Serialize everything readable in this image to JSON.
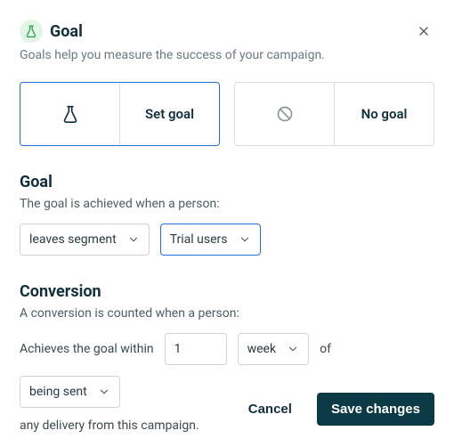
{
  "header": {
    "title": "Goal",
    "subtitle": "Goals help you measure the success of your campaign."
  },
  "options": {
    "set_goal": "Set goal",
    "no_goal": "No goal"
  },
  "goal": {
    "heading": "Goal",
    "subtitle": "The goal is achieved when a person:",
    "condition": "leaves segment",
    "segment": "Trial users"
  },
  "conversion": {
    "heading": "Conversion",
    "subtitle": "A conversion is counted when a person:",
    "prefix": "Achieves the goal within",
    "amount": "1",
    "unit": "week",
    "of_word": "of",
    "event": "being sent",
    "suffix": "any delivery from this campaign."
  },
  "footer": {
    "cancel": "Cancel",
    "save": "Save changes"
  }
}
